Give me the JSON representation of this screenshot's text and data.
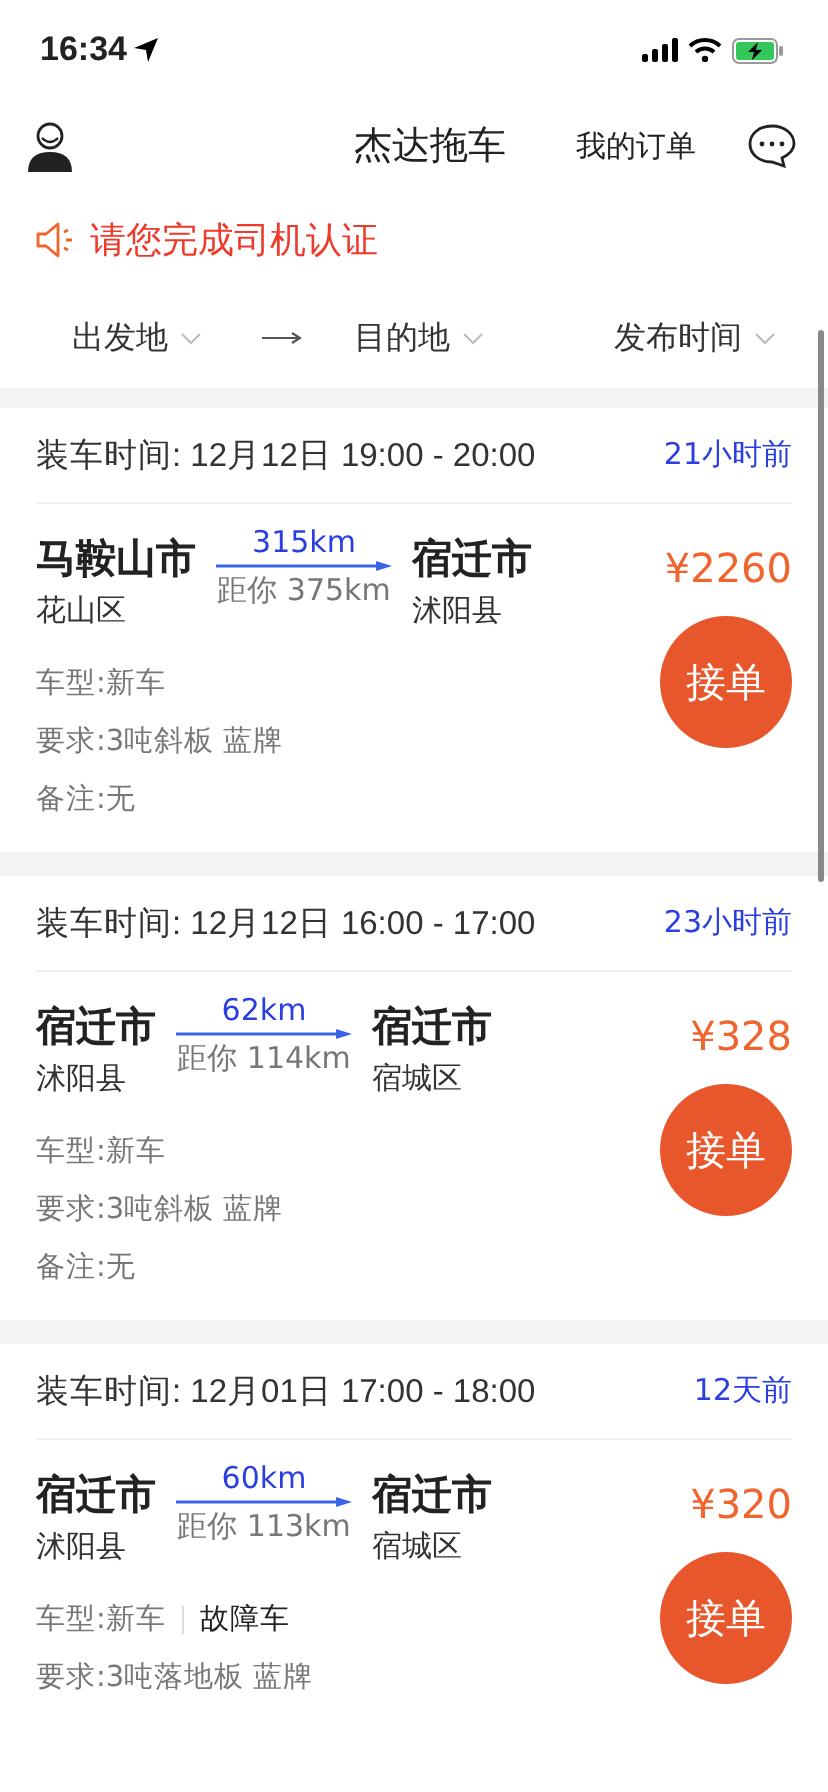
{
  "status_bar": {
    "time": "16:34"
  },
  "header": {
    "title": "杰达拖车",
    "orders_link": "我的订单"
  },
  "notice": {
    "text": "请您完成司机认证"
  },
  "filters": [
    {
      "label": "出发地",
      "kind": "dropdown"
    },
    {
      "kind": "arrow"
    },
    {
      "label": "目的地",
      "kind": "dropdown"
    },
    {
      "label": "发布时间",
      "kind": "dropdown"
    }
  ],
  "orders": [
    {
      "load_time": "装车时间: 12月12日 19:00 - 20:00",
      "posted": "21小时前",
      "from_city": "马鞍山市",
      "from_district": "花山区",
      "distance": "315km",
      "distance_to_you": "距你 375km",
      "to_city": "宿迁市",
      "to_district": "沭阳县",
      "price": "¥2260",
      "vehicle_type": "车型:新车",
      "requirement": "要求:3吨斜板 蓝牌",
      "remark": "备注:无",
      "accept_button": "接单"
    },
    {
      "load_time": "装车时间: 12月12日 16:00 - 17:00",
      "posted": "23小时前",
      "from_city": "宿迁市",
      "from_district": "沭阳县",
      "distance": "62km",
      "distance_to_you": "距你 114km",
      "to_city": "宿迁市",
      "to_district": "宿城区",
      "price": "¥328",
      "vehicle_type": "车型:新车",
      "requirement": "要求:3吨斜板 蓝牌",
      "remark": "备注:无",
      "accept_button": "接单"
    },
    {
      "load_time": "装车时间: 12月01日 17:00 - 18:00",
      "posted": "12天前",
      "from_city": "宿迁市",
      "from_district": "沭阳县",
      "distance": "60km",
      "distance_to_you": "距你 113km",
      "to_city": "宿迁市",
      "to_district": "宿城区",
      "price": "¥320",
      "vehicle_type": "车型:新车",
      "vehicle_tag": "故障车",
      "requirement": "要求:3吨落地板 蓝牌",
      "accept_button": "接单"
    }
  ]
}
